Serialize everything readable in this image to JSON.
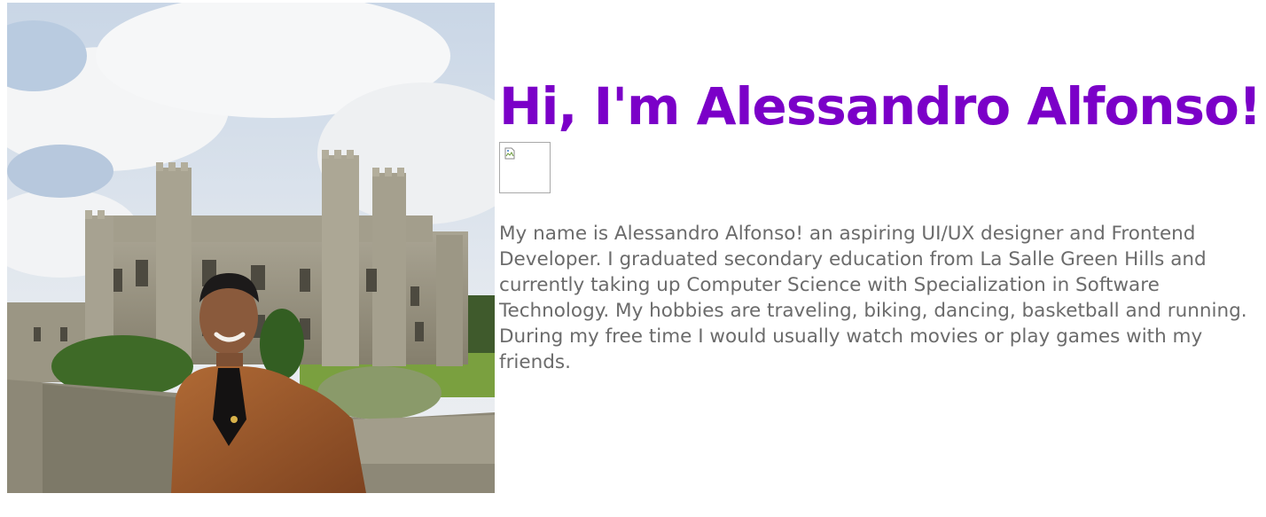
{
  "profile": {
    "heading": "Hi, I'm Alessandro Alfonso!",
    "bio": "My name is Alessandro Alfonso! an aspiring UI/UX designer and Frontend Developer. I graduated secondary education from La Salle Green Hills and currently taking up Computer Science with Specialization in Software Technology. My hobbies are traveling, biking, dancing, basketball and running. During my free time I would usually watch movies or play games with my friends.",
    "broken_image_icon": "broken-image-icon",
    "photo_icon": "castle-portrait-photo"
  },
  "colors": {
    "heading": "#7b00c8",
    "body_text": "#6b6b6b",
    "background": "#ffffff"
  }
}
